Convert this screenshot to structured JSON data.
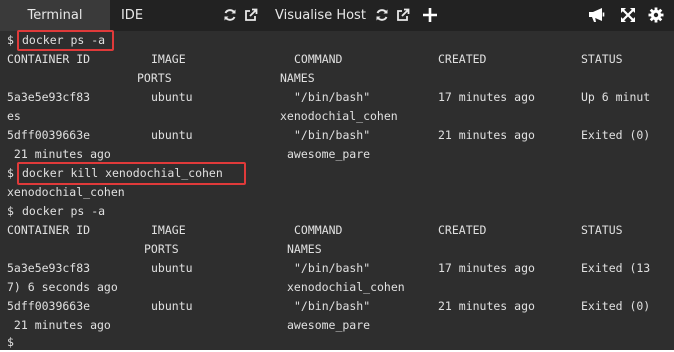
{
  "tabs": {
    "terminal": "Terminal",
    "ide": "IDE",
    "visualise": "Visualise Host"
  },
  "icons": {
    "refresh": "refresh-icon",
    "external": "external-link-icon",
    "add": "plus-icon",
    "announce": "megaphone-icon",
    "fullscreen": "expand-icon",
    "settings": "gear-icon"
  },
  "colors": {
    "highlight": "#e03a3a",
    "terminal_bg": "#2e2e2e",
    "topbar_bg": "#222222"
  },
  "terminal": {
    "prompt": "$",
    "cmd1": "docker ps -a",
    "h1_container": "CONTAINER ID",
    "h1_image": "IMAGE",
    "h1_command": "COMMAND",
    "h1_created": "CREATED",
    "h1_status": "STATUS",
    "h1_ports": "PORTS",
    "h1_names": "NAMES",
    "r1_id": "5a3e5e93cf83",
    "r1_image": "ubuntu",
    "r1_command": "\"/bin/bash\"",
    "r1_created": "17 minutes ago",
    "r1_status": "Up 6 minut",
    "r1_status_wrap": "es",
    "r1_name": "xenodochial_cohen",
    "r2_id": "5dff0039663e",
    "r2_image": "ubuntu",
    "r2_command": "\"/bin/bash\"",
    "r2_created": "21 minutes ago",
    "r2_status": "Exited (0)",
    "r2_status_wrap": " 21 minutes ago",
    "r2_name": "awesome_pare",
    "cmd2": "docker kill xenodochial_cohen",
    "cmd2_output": "xenodochial_cohen",
    "cmd3": "docker ps -a",
    "h2_container": "CONTAINER ID",
    "h2_image": "IMAGE",
    "h2_command": "COMMAND",
    "h2_created": "CREATED",
    "h2_status": "STATUS",
    "h2_ports": "PORTS",
    "h2_names": "NAMES",
    "r3_id": "5a3e5e93cf83",
    "r3_image": "ubuntu",
    "r3_command": "\"/bin/bash\"",
    "r3_created": "17 minutes ago",
    "r3_status": "Exited (13",
    "r3_status_wrap": "7) 6 seconds ago",
    "r3_name": "xenodochial_cohen",
    "r4_id": "5dff0039663e",
    "r4_image": "ubuntu",
    "r4_command": "\"/bin/bash\"",
    "r4_created": "21 minutes ago",
    "r4_status": "Exited (0)",
    "r4_status_wrap": " 21 minutes ago",
    "r4_name": "awesome_pare",
    "final_prompt": "$"
  }
}
